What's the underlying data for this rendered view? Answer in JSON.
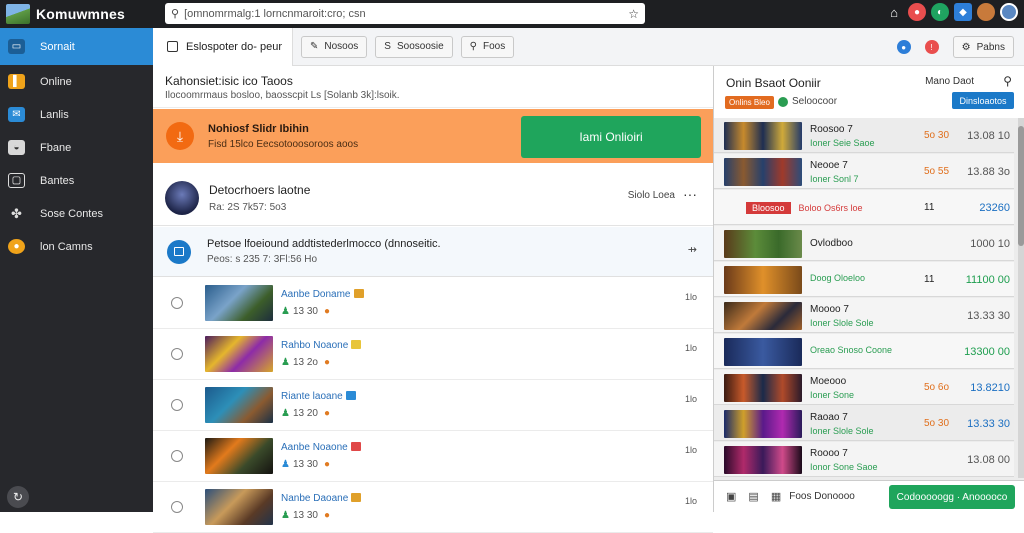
{
  "app": {
    "title": "Komuwmnes"
  },
  "search": {
    "value": "[omnomrmalg:1 lorncnmaroit:cro; csn",
    "placeholder": "Search"
  },
  "top_icons": [
    "home-icon",
    "notification-icon",
    "friends-icon",
    "store-icon",
    "avatar-1",
    "avatar-2"
  ],
  "sidebar": {
    "items": [
      {
        "label": "Sornait",
        "icon": "desktop-icon",
        "color": "#2b8bd6",
        "active": true
      },
      {
        "label": "Online",
        "icon": "online-icon",
        "color": "#f0a31a"
      },
      {
        "label": "Lanlis",
        "icon": "mail-icon",
        "color": "#2b8bd6"
      },
      {
        "label": "Fbane",
        "icon": "gamepad-icon",
        "color": "#555"
      },
      {
        "label": "Bantes",
        "icon": "monitor-icon",
        "color": "#555"
      },
      {
        "label": "Sose Contes",
        "icon": "puzzle-icon",
        "color": "#555"
      },
      {
        "label": "lon Camns",
        "icon": "coin-icon",
        "color": "#f0a31a"
      }
    ]
  },
  "toolbar": {
    "tab_label": "Eslospoter do- peur",
    "buttons": [
      {
        "label": "Nosoos",
        "icon": "wrench-icon"
      },
      {
        "label": "Soosoosie",
        "icon": "dollar-icon"
      },
      {
        "label": "Foos",
        "icon": "search-icon"
      }
    ],
    "right_button": "Pabns"
  },
  "info": {
    "title": "Kahonsiet:isic ico Taoos",
    "subtitle": "Ilocoomrmaus bosloo, baosscpit Ls [Solanb 3k]:lsoik."
  },
  "banner": {
    "title": "Nohiosf Slidr Ibihin",
    "subtitle": "Fisd 15lco Eecsotooosoroos aoos",
    "button": "Iami Onlioiri"
  },
  "news": {
    "title": "Detocrhoers laotne",
    "meta": "Ra: 2S 7k57: 5o3",
    "right": "Siolo Loea"
  },
  "notice": {
    "title": "Petsoe lfoeiound addtistederlmocco (dnnoseitic.",
    "meta": "Peos: s 235 7: 3Fl:56 Ho"
  },
  "list": [
    {
      "title": "Aanbe Doname",
      "meta": "13 30",
      "size": "1lo",
      "thumb": "a",
      "tag": "#e0a02a"
    },
    {
      "title": "Rahbo Noaone",
      "meta": "13 2o",
      "size": "1lo",
      "thumb": "b",
      "tag": "#e8c53a"
    },
    {
      "title": "Riante laoane",
      "meta": "13 20",
      "size": "1lo",
      "thumb": "c",
      "tag": "#2b8bd6"
    },
    {
      "title": "Aanbe Noaone",
      "meta": "13 30",
      "size": "1lo",
      "thumb": "d",
      "tag": "#e04848"
    },
    {
      "title": "Nanbe Daoane",
      "meta": "13 30",
      "size": "1lo",
      "thumb": "e",
      "tag": "#e0a02a"
    }
  ],
  "right": {
    "title": "Onin Bsaot Ooniir",
    "header_right": "Mano Daot",
    "pill": "Onlins Bleo",
    "pill_text": "Seloocoor",
    "button": "Dinsloaotos",
    "rows": [
      {
        "type": "game",
        "name": "Roosoo 7",
        "sub": "Ioner Seie Saoe",
        "price": "5o 30",
        "value": "13.08 10",
        "vcolor": "gr",
        "thumb": "t1"
      },
      {
        "type": "game",
        "name": "Neooe 7",
        "sub": "Ioner Sonl 7",
        "price": "5o 55",
        "value": "13.88 3o",
        "vcolor": "gr",
        "thumb": "t2"
      },
      {
        "type": "wide",
        "name": "Bloosoo",
        "sub": "Boloo Os6rs loe",
        "qty": "11",
        "value": "23260",
        "vcolor": "b",
        "thumb": "t3"
      },
      {
        "type": "game",
        "name": "Ovlodboo",
        "sub": "",
        "qty": "",
        "value": "1000 10",
        "vcolor": "gr",
        "thumb": "t4"
      },
      {
        "type": "wide",
        "name": "",
        "sub": "Doog Oloeloo",
        "qty": "11",
        "value": "11100 00",
        "vcolor": "g",
        "thumb": "t5"
      },
      {
        "type": "game",
        "name": "Moooo 7",
        "sub": "Ioner Slole Sole",
        "price": "",
        "value": "13.33 30",
        "vcolor": "gr",
        "thumb": "t6"
      },
      {
        "type": "wide",
        "name": "",
        "sub": "Oreao Snoso Coone",
        "qty": "",
        "value": "13300 00",
        "vcolor": "g",
        "thumb": "t7"
      },
      {
        "type": "game",
        "name": "Moeooo",
        "sub": "Ioner Sone",
        "price": "5o 6o",
        "value": "13.8210",
        "vcolor": "b",
        "thumb": "t8"
      },
      {
        "type": "game",
        "name": "Raoao 7",
        "sub": "Ioner Slole Sole",
        "price": "5o 30",
        "value": "13.33 30",
        "vcolor": "b",
        "thumb": "t9"
      },
      {
        "type": "game",
        "name": "Roooo 7",
        "sub": "Ionor Sone Saoe",
        "price": "",
        "value": "13.08 00",
        "vcolor": "gr",
        "thumb": "t10"
      }
    ],
    "footer_text": "Foos Donoooo",
    "footer_button": "Codooooogg · Anooooco"
  },
  "colors": {
    "accent": "#2b8bd6",
    "banner": "#fb9f5a",
    "primary_green": "#1fa55c"
  }
}
